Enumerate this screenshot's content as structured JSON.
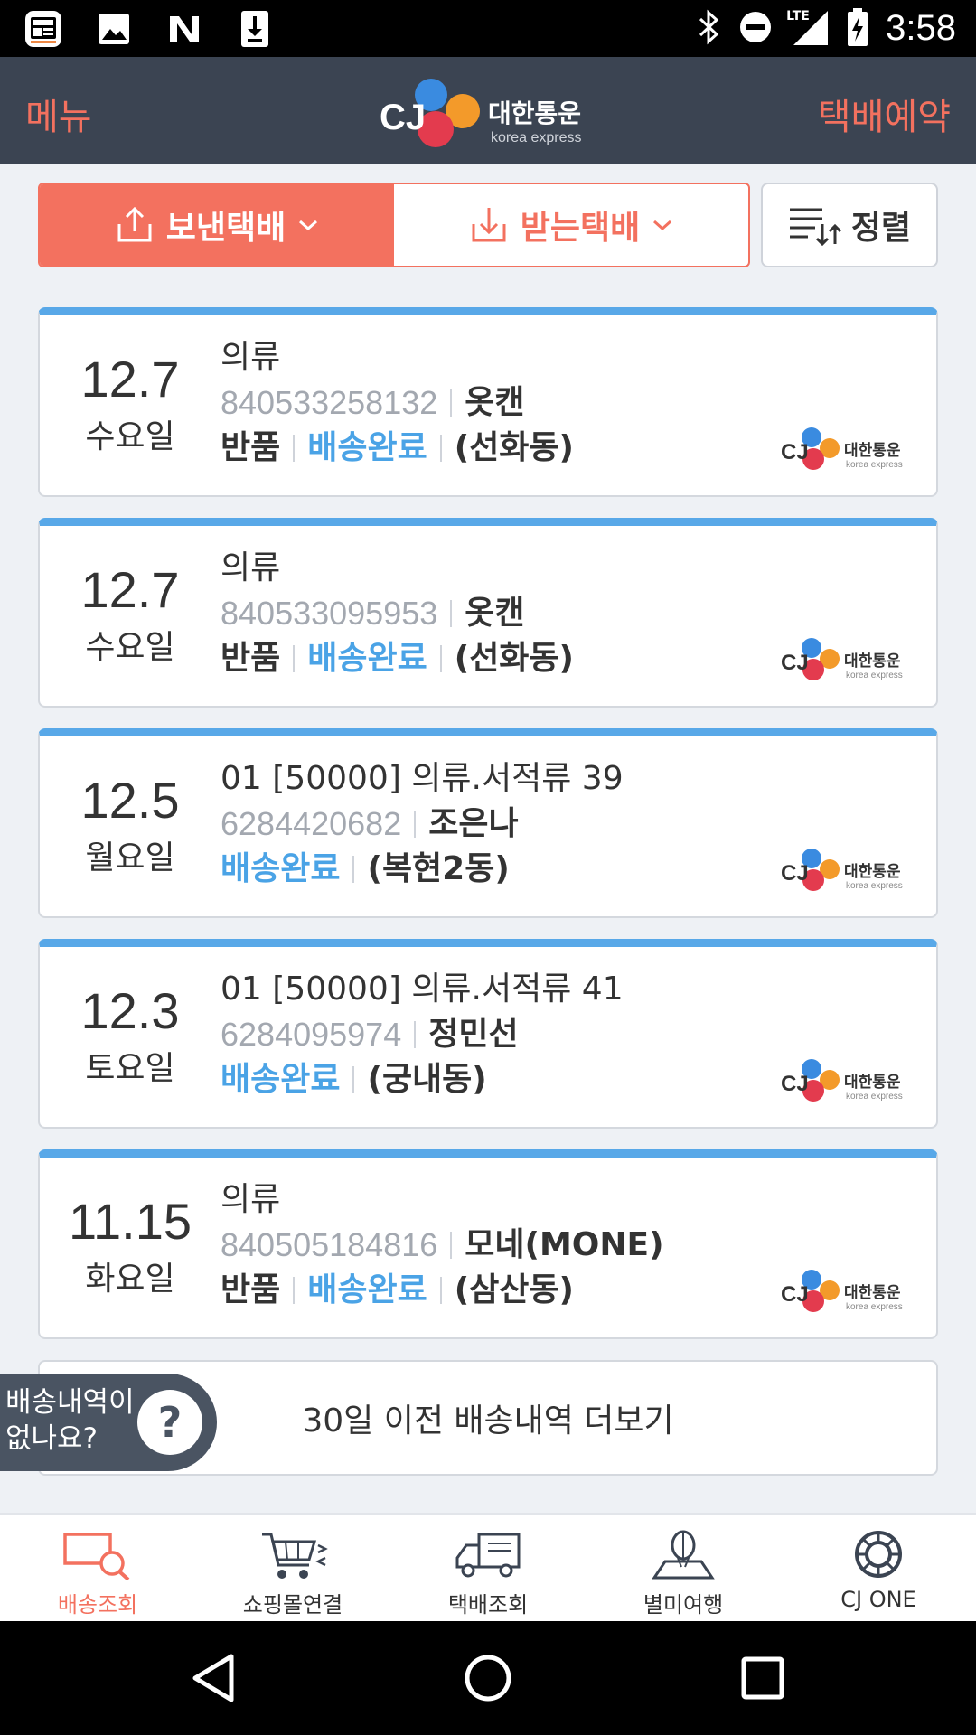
{
  "status_bar": {
    "time": "3:58",
    "network": "LTE"
  },
  "header": {
    "menu_label": "메뉴",
    "reserve_label": "택배예약",
    "logo_text": "대한통운",
    "logo_sub": "korea express",
    "logo_cj": "CJ"
  },
  "tabs": {
    "sent_label": "보낸택배",
    "received_label": "받는택배",
    "sort_label": "정렬"
  },
  "parcels": [
    {
      "date": "12.7",
      "weekday": "수요일",
      "item": "의류",
      "tracking": "840533258132",
      "sender": "옷캔",
      "tag": "반품",
      "status": "배송완료",
      "location": "(선화동)"
    },
    {
      "date": "12.7",
      "weekday": "수요일",
      "item": "의류",
      "tracking": "840533095953",
      "sender": "옷캔",
      "tag": "반품",
      "status": "배송완료",
      "location": "(선화동)"
    },
    {
      "date": "12.5",
      "weekday": "월요일",
      "item": "01 [50000] 의류.서적류 39",
      "tracking": "6284420682",
      "sender": "조은나",
      "tag": "",
      "status": "배송완료",
      "location": "(복현2동)"
    },
    {
      "date": "12.3",
      "weekday": "토요일",
      "item": "01 [50000] 의류.서적류 41",
      "tracking": "6284095974",
      "sender": "정민선",
      "tag": "",
      "status": "배송완료",
      "location": "(궁내동)"
    },
    {
      "date": "11.15",
      "weekday": "화요일",
      "item": "의류",
      "tracking": "840505184816",
      "sender": "모네(MONE)",
      "tag": "반품",
      "status": "배송완료",
      "location": "(삼산동)"
    }
  ],
  "more_history": "30일 이전 배송내역 더보기",
  "help": {
    "line1": "배송내역이",
    "line2": "없나요?",
    "icon": "?"
  },
  "bottom_nav": [
    {
      "label": "배송조회",
      "icon": "search-delivery-icon",
      "active": true
    },
    {
      "label": "쇼핑몰연결",
      "icon": "cart-icon",
      "active": false
    },
    {
      "label": "택배조회",
      "icon": "truck-icon",
      "active": false
    },
    {
      "label": "별미여행",
      "icon": "balloon-map-icon",
      "active": false
    },
    {
      "label": "CJ ONE",
      "icon": "cj-one-icon",
      "active": false
    }
  ],
  "colors": {
    "accent": "#f3715f",
    "header_bg": "#3b4452",
    "status_blue": "#4aa3e6",
    "card_top": "#58a8e8"
  }
}
